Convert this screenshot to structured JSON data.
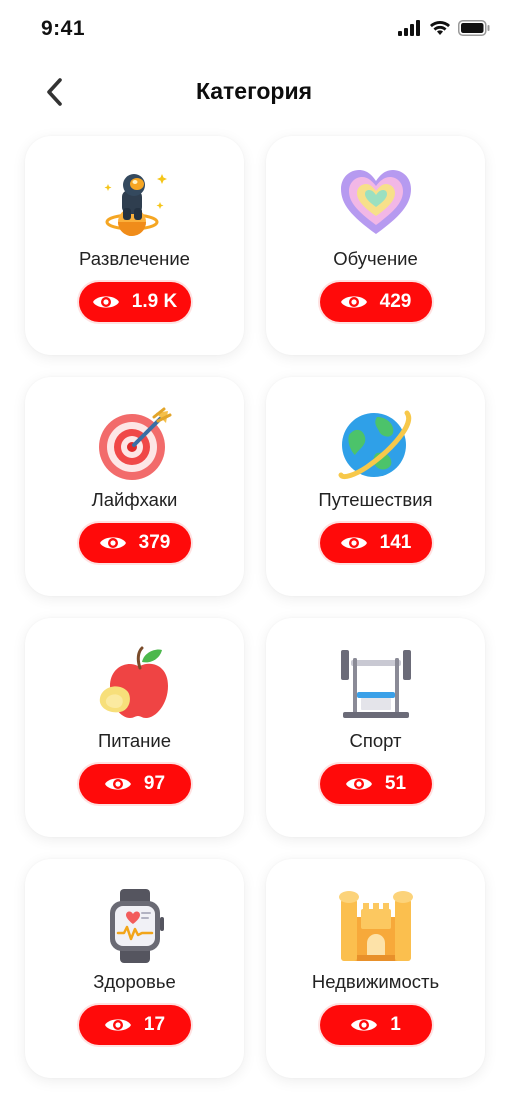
{
  "status_bar": {
    "time": "9:41"
  },
  "header": {
    "title": "Категория"
  },
  "categories": [
    {
      "label": "Развлечение",
      "count": "1.9 K",
      "icon": "astronaut-icon"
    },
    {
      "label": "Обучение",
      "count": "429",
      "icon": "heart-icon"
    },
    {
      "label": "Лайфхаки",
      "count": "379",
      "icon": "target-icon"
    },
    {
      "label": "Путешествия",
      "count": "141",
      "icon": "planet-icon"
    },
    {
      "label": "Питание",
      "count": "97",
      "icon": "apple-icon"
    },
    {
      "label": "Спорт",
      "count": "51",
      "icon": "bench-press-icon"
    },
    {
      "label": "Здоровье",
      "count": "17",
      "icon": "smartwatch-icon"
    },
    {
      "label": "Недвижимость",
      "count": "1",
      "icon": "castle-icon"
    }
  ],
  "colors": {
    "accent": "#ff0a0a",
    "card_bg": "#ffffff"
  }
}
